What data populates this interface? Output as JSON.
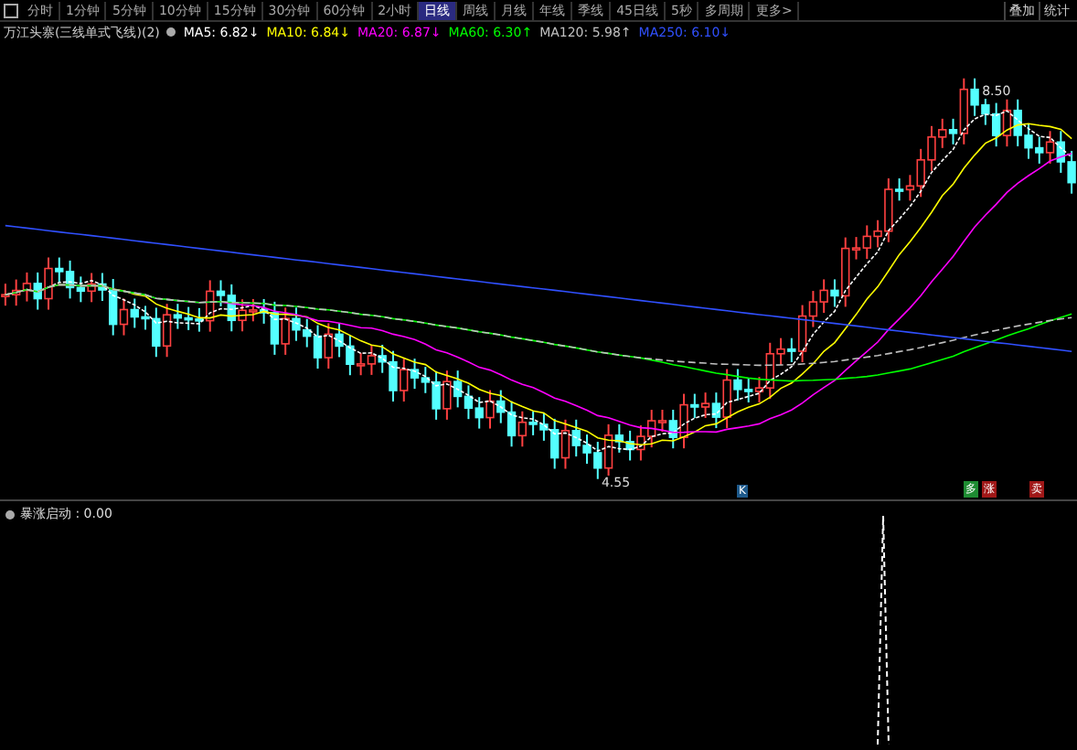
{
  "toolbar": {
    "tabs": [
      {
        "label": "分时",
        "selected": false
      },
      {
        "label": "1分钟",
        "selected": false
      },
      {
        "label": "5分钟",
        "selected": false
      },
      {
        "label": "10分钟",
        "selected": false
      },
      {
        "label": "15分钟",
        "selected": false
      },
      {
        "label": "30分钟",
        "selected": false
      },
      {
        "label": "60分钟",
        "selected": false
      },
      {
        "label": "2小时",
        "selected": false
      },
      {
        "label": "日线",
        "selected": true
      },
      {
        "label": "周线",
        "selected": false
      },
      {
        "label": "月线",
        "selected": false
      },
      {
        "label": "年线",
        "selected": false
      },
      {
        "label": "季线",
        "selected": false
      },
      {
        "label": "45日线",
        "selected": false
      },
      {
        "label": "5秒",
        "selected": false
      },
      {
        "label": "多周期",
        "selected": false
      },
      {
        "label": "更多>",
        "selected": false
      }
    ],
    "right_buttons": [
      "叠加",
      "统计"
    ]
  },
  "indicator_row": {
    "title": "万江头寨(三线单式飞线)(2)",
    "averages": [
      {
        "label": "MA5: 6.82",
        "color": "#ffffff",
        "arrow": "↓"
      },
      {
        "label": "MA10: 6.84",
        "color": "#ffff00",
        "arrow": "↓"
      },
      {
        "label": "MA20: 6.87",
        "color": "#ff00ff",
        "arrow": "↓"
      },
      {
        "label": "MA60: 6.30",
        "color": "#00ff00",
        "arrow": "↑"
      },
      {
        "label": "MA120: 5.98",
        "color": "#c0c0c0",
        "arrow": "↑"
      },
      {
        "label": "MA250: 6.10",
        "color": "#3050ff",
        "arrow": "↓"
      }
    ]
  },
  "main_chart": {
    "high_label": "8.50",
    "low_label": "4.55",
    "markers": [
      {
        "text": "K",
        "color": "#1e5a8c"
      },
      {
        "text": "多",
        "color": "#1e8c32"
      },
      {
        "text": "涨",
        "color": "#a01818"
      },
      {
        "text": "卖",
        "color": "#a01818"
      }
    ]
  },
  "sub_chart": {
    "label": "暴涨启动 : 0.00"
  }
}
